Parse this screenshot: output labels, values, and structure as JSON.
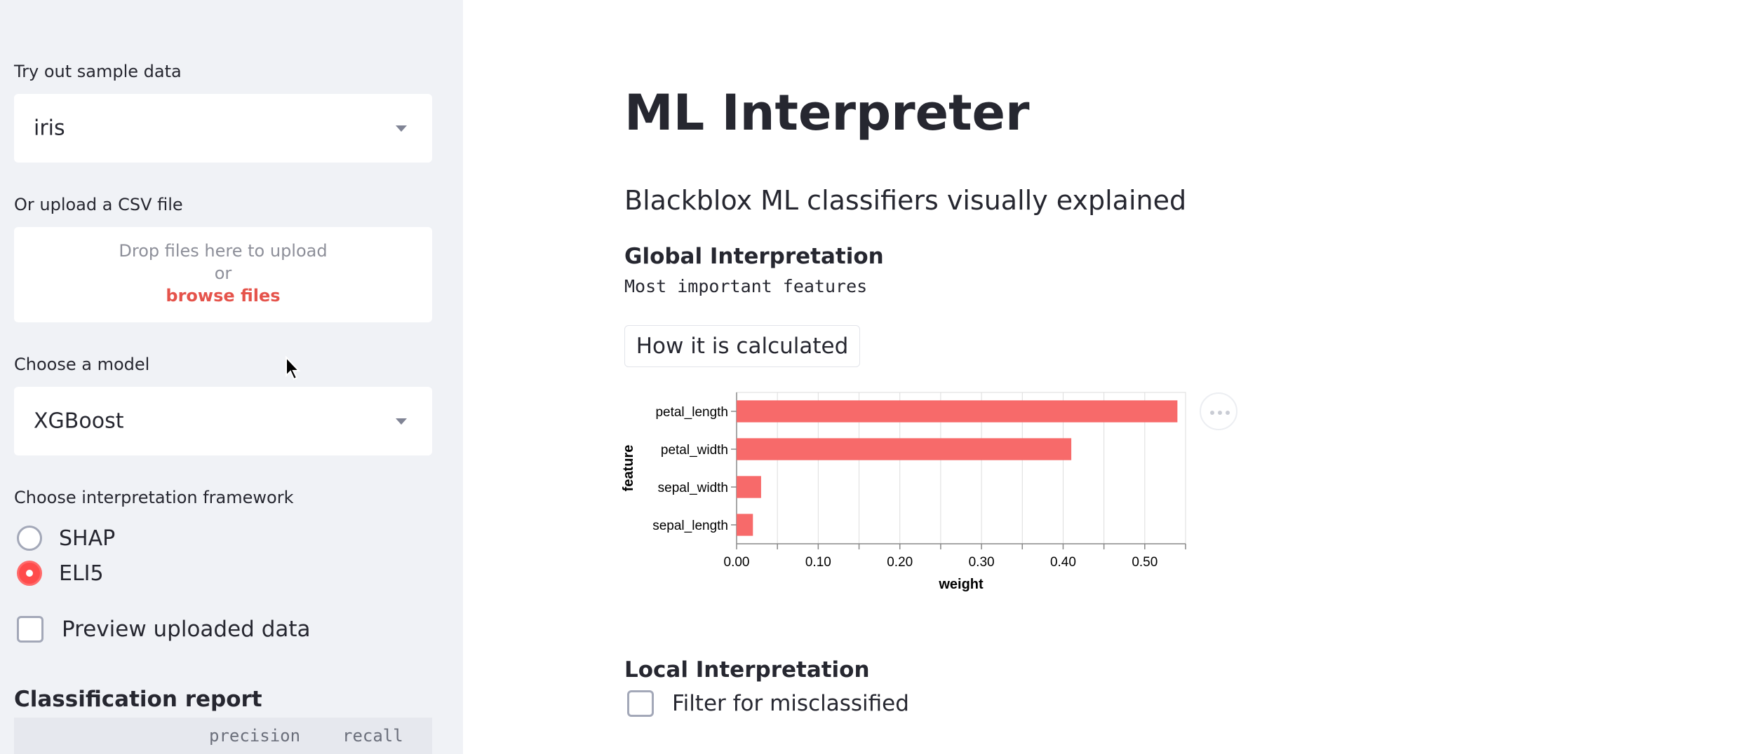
{
  "sidebar": {
    "sample_label": "Try out sample data",
    "sample_value": "iris",
    "upload_label": "Or upload a CSV file",
    "upload_drop": "Drop files here to upload",
    "upload_or": "or",
    "upload_browse": "browse files",
    "model_label": "Choose a model",
    "model_value": "XGBoost",
    "framework_label": "Choose interpretation framework",
    "framework_options": [
      {
        "label": "SHAP",
        "selected": false
      },
      {
        "label": "ELI5",
        "selected": true
      }
    ],
    "preview_label": "Preview uploaded data",
    "report_title": "Classification report",
    "report_headers": [
      "precision",
      "recall"
    ]
  },
  "main": {
    "title": "ML Interpreter",
    "subtitle": "Blackblox ML classifiers visually explained",
    "global_heading": "Global Interpretation",
    "global_mono": "Most important features",
    "how_button": "How it is calculated",
    "local_heading": "Local Interpretation",
    "filter_label": "Filter for misclassified"
  },
  "chart_data": {
    "type": "bar",
    "orientation": "horizontal",
    "categories": [
      "petal_length",
      "petal_width",
      "sepal_width",
      "sepal_length"
    ],
    "values": [
      0.54,
      0.41,
      0.03,
      0.02
    ],
    "xlabel": "weight",
    "ylabel": "feature",
    "xlim": [
      0,
      0.55
    ],
    "xticks": [
      0.0,
      0.05,
      0.1,
      0.15,
      0.2,
      0.25,
      0.3,
      0.35,
      0.4,
      0.45,
      0.5,
      0.55
    ],
    "xtick_labels": [
      "0.00",
      "",
      "0.10",
      "",
      "0.20",
      "",
      "0.30",
      "",
      "0.40",
      "",
      "0.50",
      ""
    ],
    "grid": true,
    "bar_color": "#f76a6a"
  },
  "colors": {
    "accent": "#ff4b4b",
    "sidebar_bg": "#f0f2f6",
    "text": "#262730"
  }
}
